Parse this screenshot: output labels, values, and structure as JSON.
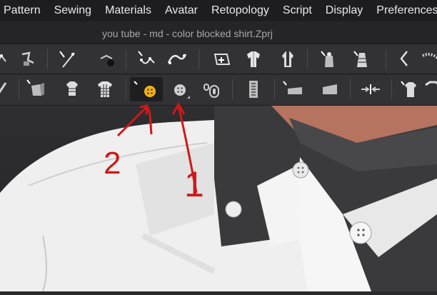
{
  "menu": {
    "items": [
      "Pattern",
      "Sewing",
      "Materials",
      "Avatar",
      "Retopology",
      "Script",
      "Display",
      "Preferences"
    ]
  },
  "window": {
    "title": "you tube - md - color blocked shirt.Zprj"
  },
  "annotations": {
    "label_1": "1",
    "label_2": "2"
  },
  "colors": {
    "accent": "#f0b21b",
    "annotation": "#d01818",
    "shirt_white": "#f2f2f2",
    "collar_dark": "#3c3c3e"
  },
  "toolbar_icons": [
    "transform-pattern-icon",
    "edit-pattern-icon",
    "edit-curvature-icon",
    "segment-sewing-icon",
    "free-sewing-icon",
    "fold-arrangement-icon",
    "simulation-icon",
    "garment-fit-icon",
    "avatar-measure-icon",
    "tape-measure-icon",
    "select-texture-icon",
    "edit-graphic-icon",
    "topstitch-icon",
    "puckering-icon",
    "button-icon",
    "select-button-icon",
    "buttonhole-icon",
    "zipper-icon",
    "trim-icon",
    "tacking-icon",
    "pin-icon",
    "hanger-icon"
  ]
}
